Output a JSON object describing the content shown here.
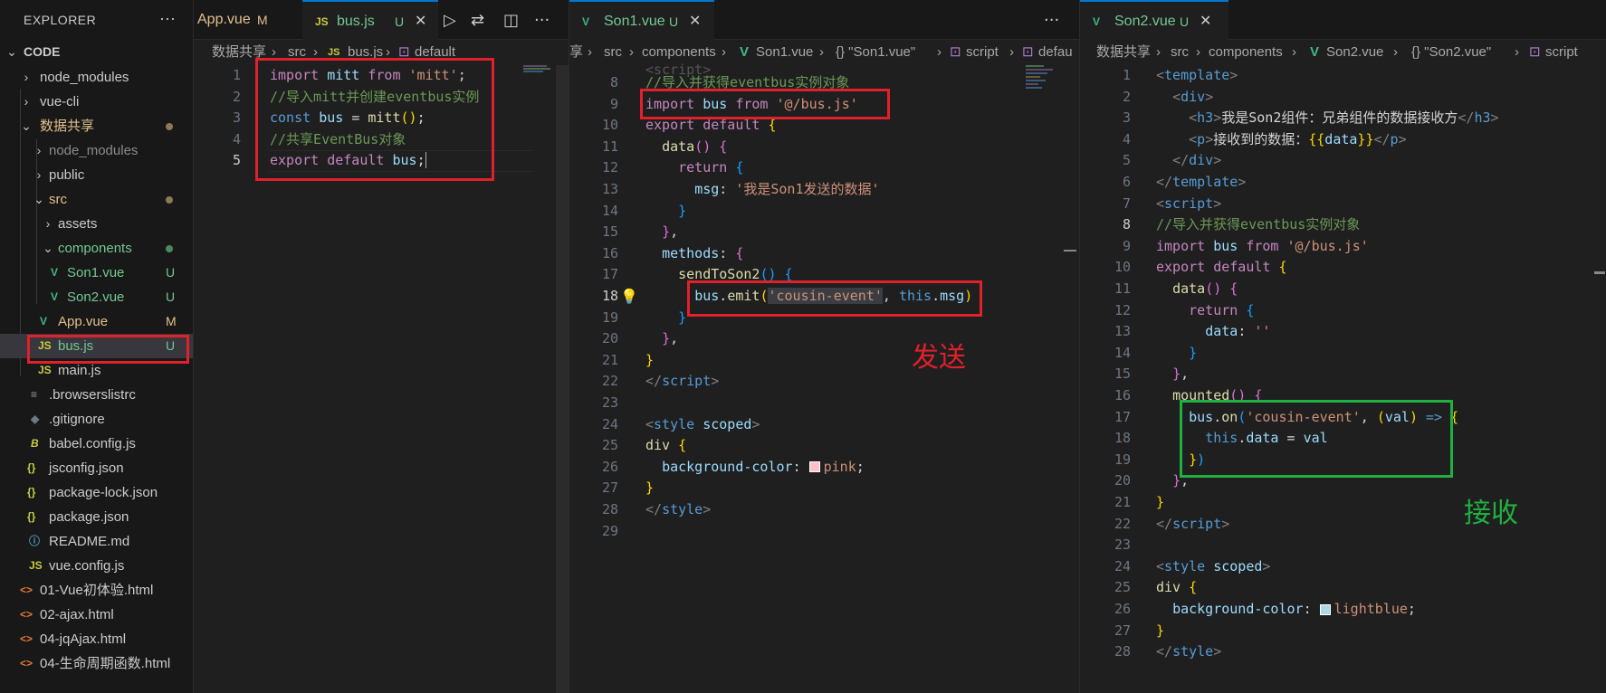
{
  "sidebar": {
    "title": "EXPLORER",
    "root": "CODE",
    "items": [
      {
        "label": "node_modules",
        "badge": ""
      },
      {
        "label": "vue-cli",
        "badge": ""
      },
      {
        "label": "数据共享",
        "badge": ""
      },
      {
        "label": "node_modules",
        "badge": ""
      },
      {
        "label": "public",
        "badge": ""
      },
      {
        "label": "src",
        "badge": ""
      },
      {
        "label": "assets",
        "badge": ""
      },
      {
        "label": "components",
        "badge": ""
      },
      {
        "label": "Son1.vue",
        "badge": "U"
      },
      {
        "label": "Son2.vue",
        "badge": "U"
      },
      {
        "label": "App.vue",
        "badge": "M"
      },
      {
        "label": "bus.js",
        "badge": "U"
      },
      {
        "label": "main.js",
        "badge": ""
      },
      {
        "label": ".browserslistrc",
        "badge": ""
      },
      {
        "label": ".gitignore",
        "badge": ""
      },
      {
        "label": "babel.config.js",
        "badge": ""
      },
      {
        "label": "jsconfig.json",
        "badge": ""
      },
      {
        "label": "package-lock.json",
        "badge": ""
      },
      {
        "label": "package.json",
        "badge": ""
      },
      {
        "label": "README.md",
        "badge": ""
      },
      {
        "label": "vue.config.js",
        "badge": ""
      },
      {
        "label": "01-Vue初体验.html",
        "badge": ""
      },
      {
        "label": "02-ajax.html",
        "badge": ""
      },
      {
        "label": "04-jqAjax.html",
        "badge": ""
      },
      {
        "label": "04-生命周期函数.html",
        "badge": ""
      }
    ]
  },
  "editor1": {
    "tabs": [
      {
        "label": "App.vue",
        "status": "M"
      },
      {
        "label": "bus.js",
        "status": "U"
      }
    ],
    "breadcrumb": [
      "数据共享",
      "src",
      "bus.js",
      "default"
    ],
    "lines": [
      "1",
      "2",
      "3",
      "4",
      "5"
    ]
  },
  "editor2": {
    "tab": {
      "label": "Son1.vue",
      "status": "U"
    },
    "breadcrumb": [
      "享",
      "src",
      "components",
      "Son1.vue",
      "{} \"Son1.vue\"",
      "script",
      "defau"
    ],
    "lines": [
      "8",
      "9",
      "10",
      "11",
      "12",
      "13",
      "14",
      "15",
      "16",
      "17",
      "18",
      "19",
      "20",
      "21",
      "22",
      "23",
      "24",
      "25",
      "26",
      "27",
      "28",
      "29"
    ],
    "annotation": "发送"
  },
  "editor3": {
    "tab": {
      "label": "Son2.vue",
      "status": "U"
    },
    "breadcrumb": [
      "数据共享",
      "src",
      "components",
      "Son2.vue",
      "{} \"Son2.vue\"",
      "script"
    ],
    "lines": [
      "1",
      "2",
      "3",
      "4",
      "5",
      "6",
      "7",
      "8",
      "9",
      "10",
      "11",
      "12",
      "13",
      "14",
      "15",
      "16",
      "17",
      "18",
      "19",
      "20",
      "21",
      "22",
      "23",
      "24",
      "25",
      "26",
      "27",
      "28"
    ],
    "annotation": "接收"
  },
  "colors": {
    "accent": "#0078d4",
    "highlight_red": "#e0202a",
    "highlight_green": "#20b040"
  }
}
